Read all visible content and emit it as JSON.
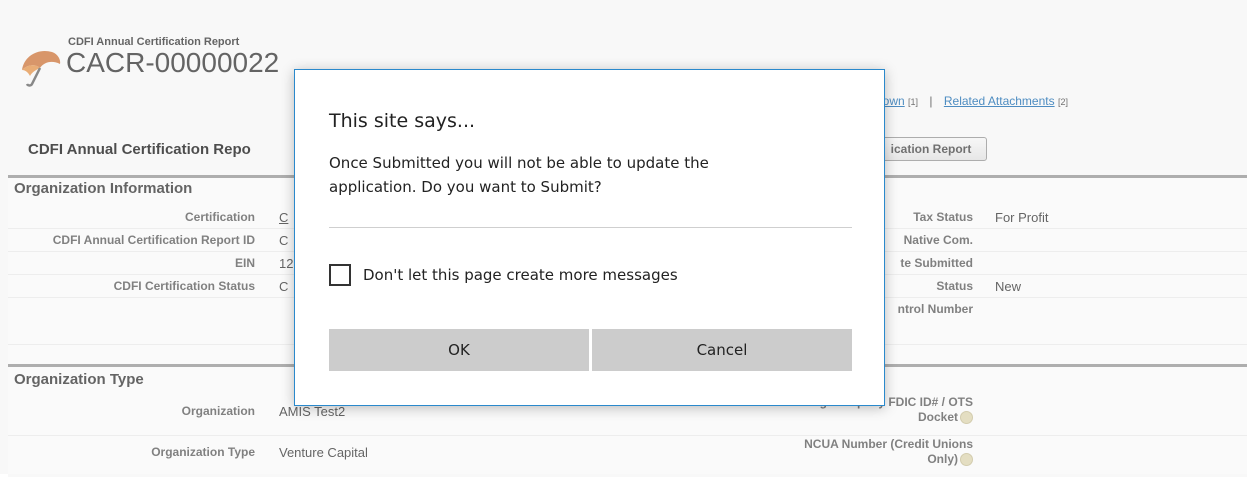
{
  "header": {
    "subtitle": "CDFI Annual Certification Report",
    "title": "CACR-00000022"
  },
  "related_links": {
    "link1_text": "lown",
    "link1_count": "[1]",
    "separator": "|",
    "link2_text": "Related Attachments",
    "link2_count": "[2]"
  },
  "detail": {
    "section_title": "CDFI Annual Certification Repo",
    "button_label": "ication Report"
  },
  "org_info": {
    "heading": "Organization Information",
    "left_rows": [
      {
        "label": "Certification",
        "value": "C"
      },
      {
        "label": "CDFI Annual Certification Report ID",
        "value": "C"
      },
      {
        "label": "EIN",
        "value": "12"
      },
      {
        "label": "CDFI Certification Status",
        "value": "C"
      }
    ],
    "right_rows": [
      {
        "label": "Tax Status",
        "value": "For Profit"
      },
      {
        "label": "Native Com.",
        "value": ""
      },
      {
        "label": "te Submitted",
        "value": ""
      },
      {
        "label": "Status",
        "value": "New"
      },
      {
        "label": "ntrol Number",
        "value": ""
      }
    ]
  },
  "org_type": {
    "heading": "Organization Type",
    "rows": [
      {
        "label": "Organization",
        "value": "AMIS Test2",
        "right_label_1": "Holding Company FDIC ID# / OTS",
        "right_label_2": "Docket"
      },
      {
        "label": "Organization Type",
        "value": "Venture Capital",
        "right_label_1": "NCUA Number (Credit Unions",
        "right_label_2": "Only)"
      }
    ]
  },
  "dialog": {
    "title": "This site says...",
    "message_line1": "Once Submitted you will not be able to update the",
    "message_line2": "application. Do you want to Submit?",
    "checkbox_label": "Don't let this page create more messages",
    "ok_label": "OK",
    "cancel_label": "Cancel"
  },
  "colors": {
    "dialog_border": "#2a89cc",
    "link": "#015ba7",
    "button_gray": "#cccccc"
  }
}
